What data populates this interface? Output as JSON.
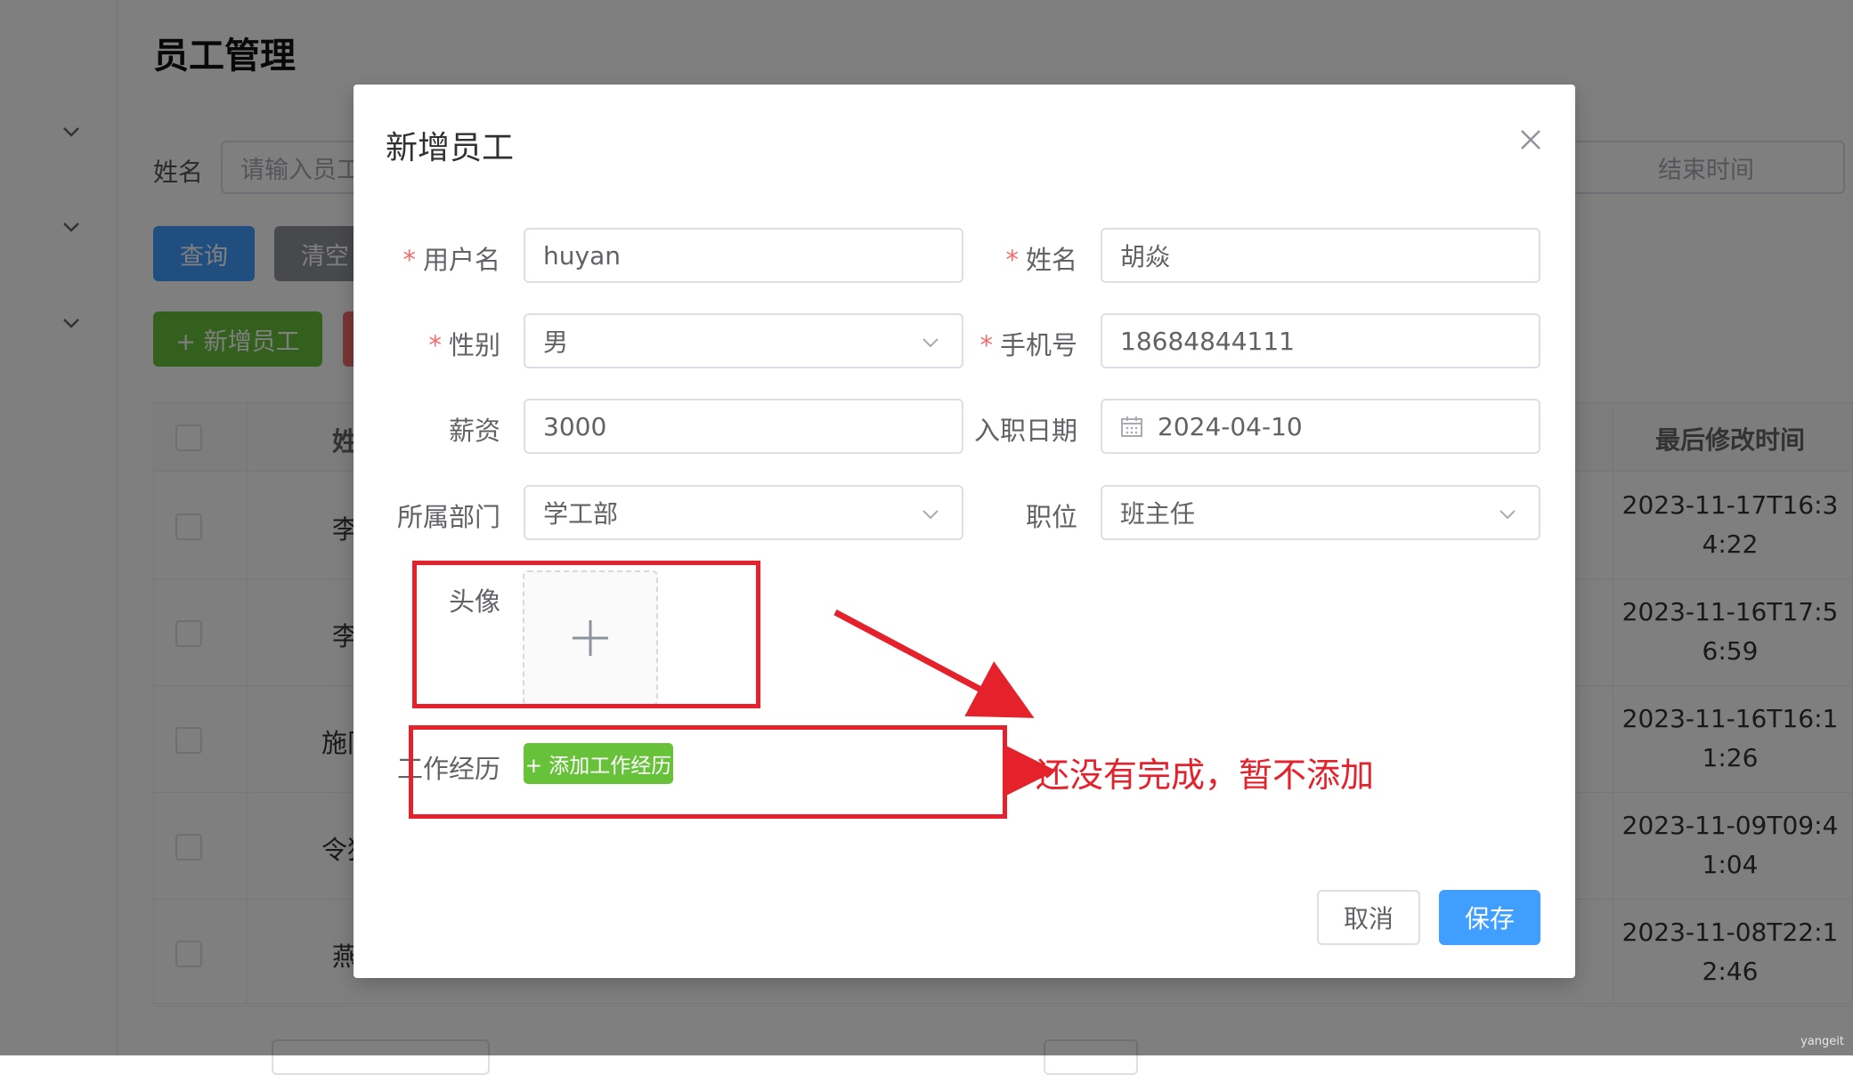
{
  "page": {
    "title": "员工管理",
    "search": {
      "name_label": "姓名",
      "name_placeholder": "请输入员工",
      "end_time_placeholder": "结束时间"
    },
    "buttons": {
      "query": "查询",
      "clear": "清空",
      "add_employee": "+ 新增员工"
    },
    "table": {
      "header_name": "姓",
      "header_update_time": "最后修改时间",
      "rows": [
        {
          "name": "李",
          "update_time": "2023-11-17T16:34:22"
        },
        {
          "name": "李",
          "update_time": "2023-11-16T17:56:59"
        },
        {
          "name": "施同",
          "update_time": "2023-11-16T16:11:26"
        },
        {
          "name": "令狐",
          "update_time": "2023-11-09T09:41:04"
        },
        {
          "name": "燕",
          "update_time": "2023-11-08T22:12:46"
        }
      ]
    }
  },
  "dialog": {
    "title": "新增员工",
    "fields": {
      "username": {
        "label": "用户名",
        "value": "huyan",
        "required": true
      },
      "name": {
        "label": "姓名",
        "value": "胡焱",
        "required": true
      },
      "gender": {
        "label": "性别",
        "value": "男",
        "required": true
      },
      "phone": {
        "label": "手机号",
        "value": "18684844111",
        "required": true
      },
      "salary": {
        "label": "薪资",
        "value": "3000"
      },
      "entry_date": {
        "label": "入职日期",
        "value": "2024-04-10"
      },
      "department": {
        "label": "所属部门",
        "value": "学工部"
      },
      "position": {
        "label": "职位",
        "value": "班主任"
      },
      "avatar": {
        "label": "头像"
      },
      "work_experience": {
        "label": "工作经历",
        "add_button": "+ 添加工作经历"
      }
    },
    "required_mark": "*",
    "cancel_label": "取消",
    "save_label": "保存"
  },
  "annotation": {
    "text": "还没有完成，暂不添加",
    "color": "#e5212b"
  },
  "watermark": "yangeit",
  "colors": {
    "primary": "#409eff",
    "success": "#67c23a",
    "danger": "#f56c6c",
    "query_button": "#409eff",
    "clear_button": "#909399"
  }
}
